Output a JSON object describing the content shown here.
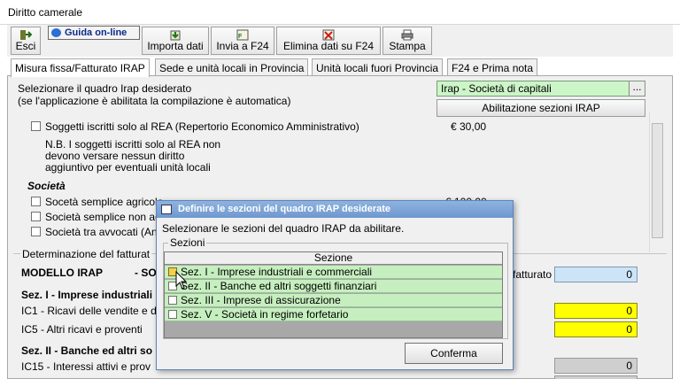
{
  "window": {
    "title": "Diritto camerale"
  },
  "toolbar": {
    "esci": "Esci",
    "guida": "Guida on-line",
    "importa": "Importa dati",
    "invia": "Invia a F24",
    "elimina": "Elimina dati su F24",
    "stampa": "Stampa"
  },
  "tabs": [
    {
      "label": "Misura fissa/Fatturato IRAP"
    },
    {
      "label": "Sede e unità locali in Provincia"
    },
    {
      "label": "Unità locali fuori Provincia"
    },
    {
      "label": "F24 e Prima nota"
    }
  ],
  "top": {
    "select_label": "Selezionare il quadro Irap desiderato",
    "select_note": "(se l'applicazione è abilitata la compilazione è automatica)",
    "quadro_value": "Irap - Società di capitali",
    "combo_button": "...",
    "abilitazione_button": "Abilitazione sezioni IRAP"
  },
  "rea": {
    "label": "Soggetti iscritti solo al REA (Repertorio Economico Amministrativo)",
    "amount": "€ 30,00",
    "note1": "N.B. I soggetti iscritti solo al REA non",
    "note2": "devono versare nessun diritto",
    "note3": "aggiuntivo per eventuali unità locali"
  },
  "societa": {
    "heading": "Società",
    "item1": "Socetà semplice agricola",
    "item1_amount": "€ 100,00",
    "item2": "Società semplice non ag",
    "item3": "Società tra avvocati (An"
  },
  "determinazione": {
    "heading": "Determinazione del fatturat",
    "modello": "MODELLO IRAP",
    "so": "- SO",
    "fatturato_label": "fatturato",
    "fatturato_value": "0",
    "sez1": "Sez. I - Imprese industriali",
    "ic1": "IC1 - Ricavi delle vendite e d",
    "ic1_value": "0",
    "ic5": "IC5 - Altri ricavi e proventi",
    "ic5_value": "0",
    "sez2": "Sez. II - Banche ed altri so",
    "ic15": "IC15 - Interessi attivi e prov",
    "ic15_value": "0",
    "gray_value": "0"
  },
  "modal": {
    "title": "Definire le sezioni del quadro IRAP desiderate",
    "description": "Selezionare le sezioni del quadro IRAP  da abilitare.",
    "group_label": "Sezioni",
    "column_header": "Sezione",
    "rows": [
      {
        "label": "Sez. I - Imprese industriali e commerciali",
        "checked": true
      },
      {
        "label": "Sez. II - Banche ed altri soggetti finanziari",
        "checked": false
      },
      {
        "label": "Sez. III - Imprese di assicurazione",
        "checked": false
      },
      {
        "label": "Sez. V - Società in regime forfetario",
        "checked": false
      }
    ],
    "confirm": "Conferma"
  }
}
